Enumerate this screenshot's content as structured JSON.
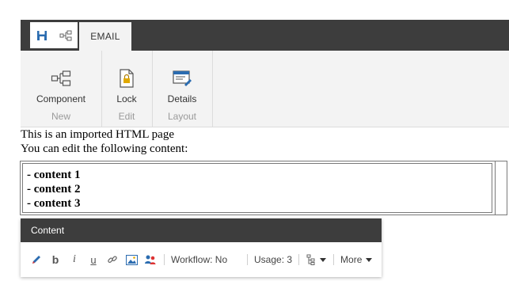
{
  "ribbon": {
    "quick_access": {
      "save_icon": "floppy-disk-icon",
      "workflow_icon": "component-tree-icon"
    },
    "active_tab": "EMAIL",
    "groups": [
      {
        "label": "New",
        "buttons": [
          {
            "label": "Component",
            "icon": "component-icon"
          }
        ]
      },
      {
        "label": "Edit",
        "buttons": [
          {
            "label": "Lock",
            "icon": "lock-icon"
          }
        ]
      },
      {
        "label": "Layout",
        "buttons": [
          {
            "label": "Details",
            "icon": "details-icon"
          }
        ]
      }
    ]
  },
  "page": {
    "line1": "This is an imported HTML page",
    "line2": "You can edit the following content:",
    "items": [
      "- content 1",
      "- content 2",
      "- content 3"
    ]
  },
  "content_toolbar": {
    "title": "Content",
    "workflow_text": "Workflow: No",
    "usage_text": "Usage: 3",
    "more_label": "More"
  },
  "colors": {
    "ribbon_dark": "#3d3d3d",
    "ribbon_light": "#f3f3f3",
    "accent_blue": "#2b6cb0"
  }
}
